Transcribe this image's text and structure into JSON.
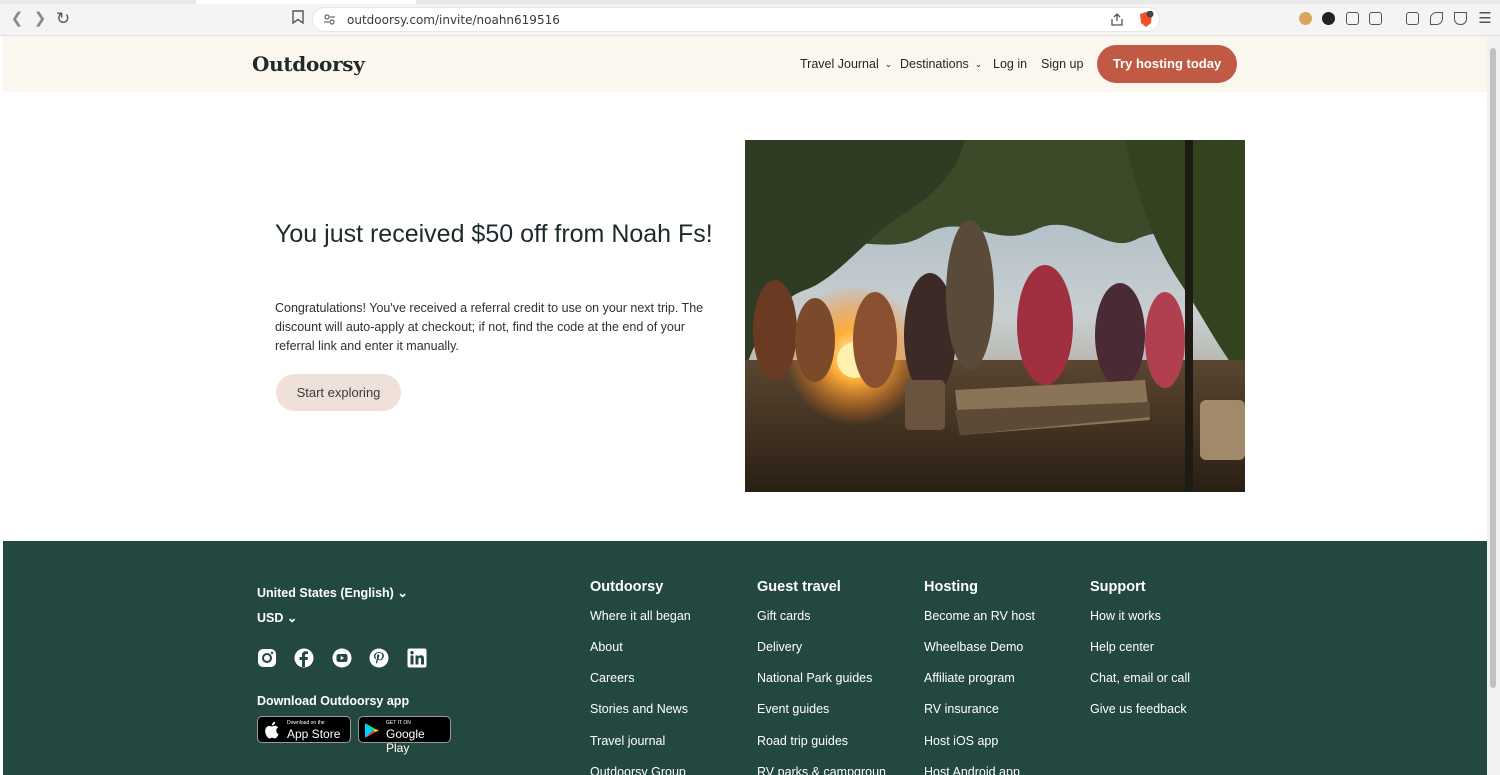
{
  "browser": {
    "url": "outdoorsy.com/invite/noahn619516"
  },
  "header": {
    "logo": "Outdoorsy",
    "nav": [
      {
        "label": "Travel Journal",
        "dropdown": true
      },
      {
        "label": "Destinations",
        "dropdown": true
      },
      {
        "label": "Log in",
        "dropdown": false
      },
      {
        "label": "Sign up",
        "dropdown": false
      }
    ],
    "cta_label": "Try hosting today"
  },
  "hero": {
    "title": "You just received $50 off from Noah Fs!",
    "body": "Congratulations! You've received a referral credit to use on your next trip. The discount will auto-apply at checkout; if not, find the code at the end of your referral link and enter it manually.",
    "button_label": "Start exploring"
  },
  "footer": {
    "locale": "United States (English)",
    "currency": "USD",
    "social_icons": [
      "instagram-icon",
      "facebook-icon",
      "youtube-icon",
      "pinterest-icon",
      "linkedin-icon"
    ],
    "download_title": "Download Outdoorsy app",
    "app_store": {
      "small": "Download on the",
      "big": "App Store"
    },
    "google_play": {
      "small": "GET IT ON",
      "big": "Google Play"
    },
    "columns": [
      {
        "title": "Outdoorsy",
        "links": [
          "Where it all began",
          "About",
          "Careers",
          "Stories and News",
          "Travel journal",
          "Outdoorsy Group"
        ]
      },
      {
        "title": "Guest travel",
        "links": [
          "Gift cards",
          "Delivery",
          "National Park guides",
          "Event guides",
          "Road trip guides",
          "RV parks & campgroun"
        ]
      },
      {
        "title": "Hosting",
        "links": [
          "Become an RV host",
          "Wheelbase Demo",
          "Affiliate program",
          "RV insurance",
          "Host iOS app",
          "Host Android app"
        ]
      },
      {
        "title": "Support",
        "links": [
          "How it works",
          "Help center",
          "Chat, email or call",
          "Give us feedback"
        ]
      }
    ]
  },
  "colors": {
    "header_bg": "#fbf7ee",
    "cta_bg": "#c05a45",
    "explore_bg": "#efe0da",
    "footer_bg": "#234840"
  }
}
